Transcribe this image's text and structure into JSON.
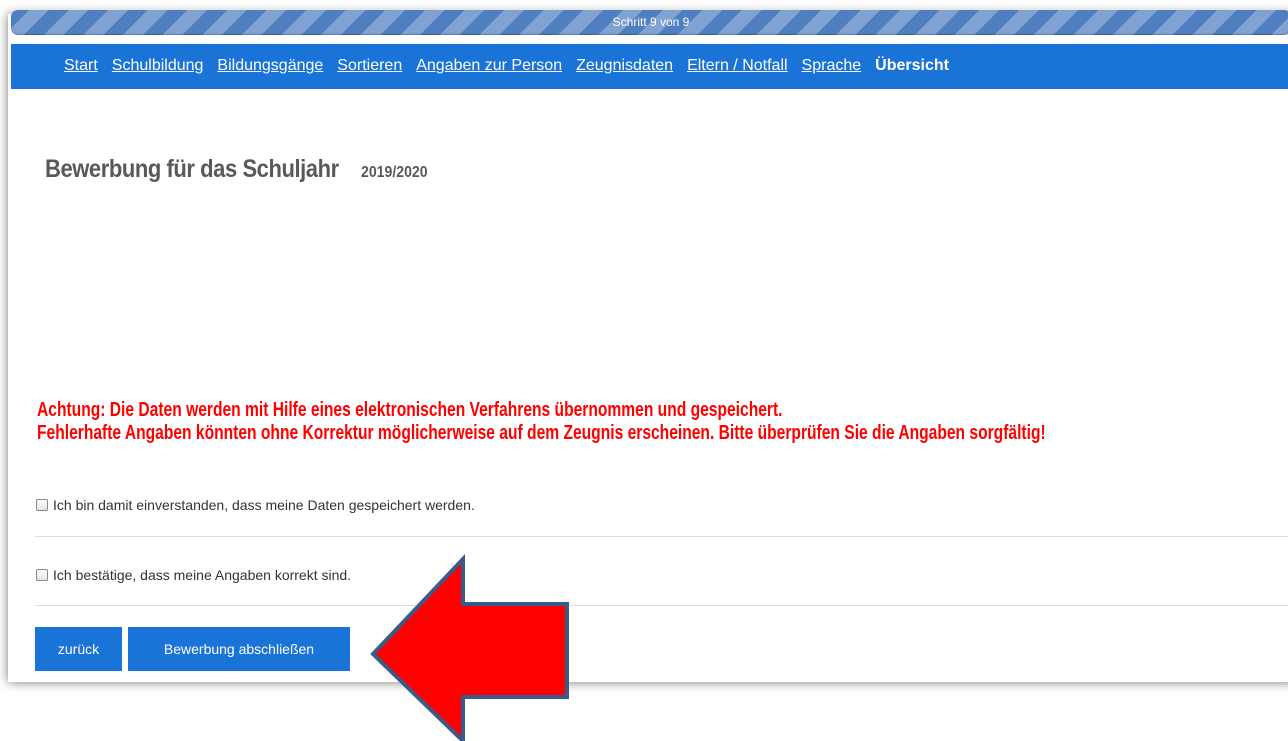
{
  "progress": {
    "label": "Schritt 9 von 9",
    "step": 9,
    "total": 9
  },
  "nav": {
    "items": [
      {
        "label": "Start",
        "current": false
      },
      {
        "label": "Schulbildung",
        "current": false
      },
      {
        "label": "Bildungsgänge",
        "current": false
      },
      {
        "label": "Sortieren",
        "current": false
      },
      {
        "label": "Angaben zur Person",
        "current": false
      },
      {
        "label": "Zeugnisdaten",
        "current": false
      },
      {
        "label": "Eltern / Notfall",
        "current": false
      },
      {
        "label": "Sprache",
        "current": false
      },
      {
        "label": "Übersicht",
        "current": true
      }
    ]
  },
  "heading": {
    "title": "Bewerbung für das Schuljahr",
    "year": "2019/2020"
  },
  "warning": {
    "line1": "Achtung: Die Daten werden mit Hilfe eines elektronischen Verfahrens übernommen und gespeichert.",
    "line2": "Fehlerhafte Angaben könnten ohne Korrektur möglicherweise auf dem Zeugnis erscheinen. Bitte überprüfen Sie die Angaben sorgfältig!"
  },
  "checkboxes": {
    "consent": {
      "label": "Ich bin damit einverstanden, dass meine Daten gespeichert werden.",
      "checked": false
    },
    "confirm": {
      "label": "Ich bestätige, dass meine Angaben korrekt sind.",
      "checked": false
    }
  },
  "buttons": {
    "back": "zurück",
    "submit": "Bewerbung abschließen"
  },
  "colors": {
    "accent": "#1a73d6",
    "warning": "#ff0000",
    "annotation_arrow": "#ff0000"
  },
  "annotation": {
    "icon": "arrow-left-icon"
  }
}
